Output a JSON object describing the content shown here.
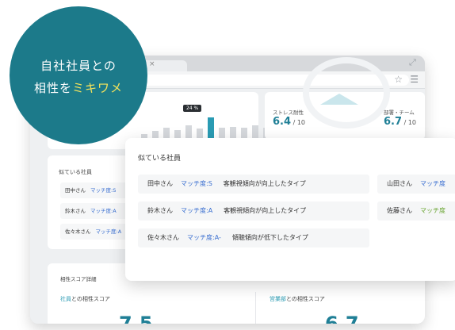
{
  "callout": {
    "line1": "自社社員との",
    "line2_prefix": "相性を",
    "line2_highlight": "ミキワメ"
  },
  "browser": {
    "tab_close": "×",
    "star_icon": "☆",
    "menu_icon": "☰",
    "expand_icon": "⤢"
  },
  "bar_chart": {
    "tooltip": "24 %",
    "values": [
      0.2,
      0.35,
      0.5,
      0.4,
      0.6,
      0.45,
      1.0,
      0.5,
      0.55,
      0.5,
      0.6,
      0.5,
      0.7
    ],
    "active_index": 6
  },
  "stress": {
    "label1": "ストレス耐性",
    "value1": "6.4",
    "denom1": " / 10",
    "label2": "部署・チーム",
    "value2": "6.7",
    "denom2": " / 10"
  },
  "list": {
    "title": "似ている社員",
    "rows": [
      {
        "name": "田中さん",
        "match": "マッチ度:S"
      },
      {
        "name": "鈴木さん",
        "match": "マッチ度:A"
      },
      {
        "name": "佐々木さん",
        "match": "マッチ度:A"
      }
    ]
  },
  "scores": {
    "title": "相性スコア詳細",
    "col1_accent": "社員",
    "col1_rest": "との相性スコア",
    "col2_accent": "営業部",
    "col2_rest": "との相性スコア",
    "big1": "7.5",
    "big2": "6.7"
  },
  "popup": {
    "title": "似ている社員",
    "rows": [
      {
        "name": "田中さん",
        "match": "マッチ度:S",
        "desc": "客観視傾向が向上したタイプ"
      },
      {
        "name": "鈴木さん",
        "match": "マッチ度:A",
        "desc": "客観視傾向が向上したタイプ"
      },
      {
        "name": "佐々木さん",
        "match": "マッチ度:A-",
        "desc": "傾聴傾向が低下したタイプ"
      }
    ],
    "side_rows": [
      {
        "name": "山田さん",
        "match": "マッチ度"
      },
      {
        "name": "佐藤さん",
        "match": "マッチ度"
      }
    ]
  }
}
